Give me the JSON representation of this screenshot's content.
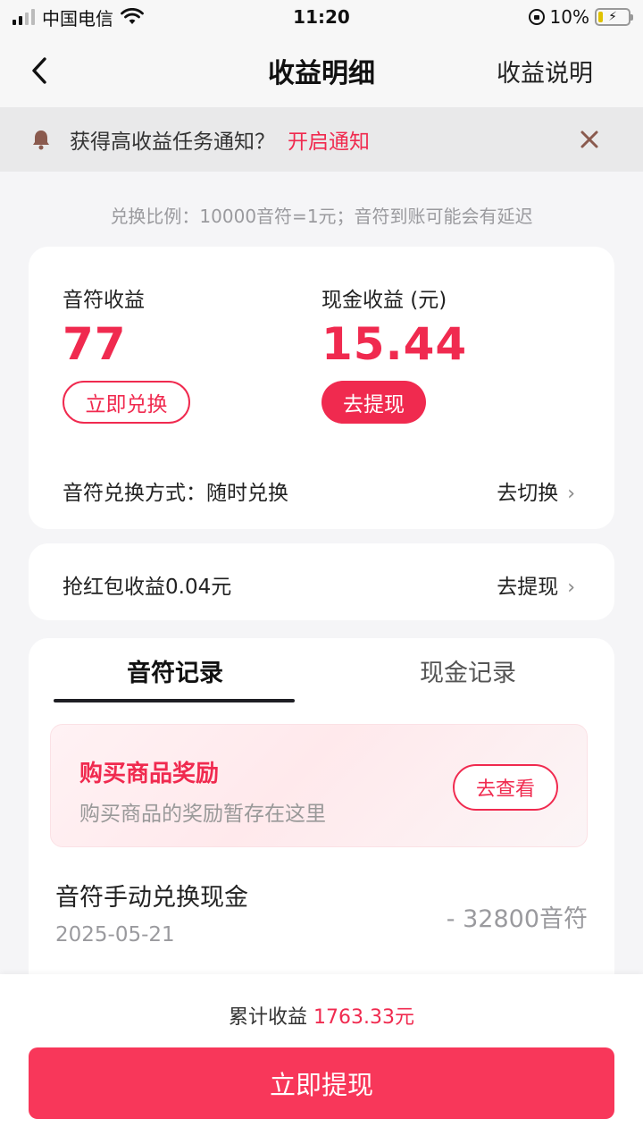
{
  "status_bar": {
    "carrier": "中国电信",
    "time": "11:20",
    "battery": "10%",
    "icons": [
      "signal-icon",
      "wifi-icon",
      "rotation-lock-icon",
      "battery-charging-icon"
    ]
  },
  "nav": {
    "title": "收益明细",
    "right_link": "收益说明",
    "back_icon": "chevron-left-icon"
  },
  "notice": {
    "text": "获得高收益任务通知？",
    "link": "开启通知",
    "icon": "bell-icon",
    "close_icon": "close-icon"
  },
  "exchange_rate": "兑换比例：10000音符=1元；音符到账可能会有延迟",
  "earnings": {
    "note_label": "音符收益",
    "note_value": "77",
    "note_button": "立即兑换",
    "cash_label": "现金收益 (元)",
    "cash_value": "15.44",
    "cash_button": "去提现",
    "mode_label": "音符兑换方式：随时兑换",
    "mode_link": "去切换"
  },
  "red_packet": {
    "label": "抢红包收益0.04元",
    "link": "去提现"
  },
  "records": {
    "tabs": [
      {
        "label": "音符记录",
        "active": true
      },
      {
        "label": "现金记录",
        "active": false
      }
    ],
    "promo": {
      "title": "购买商品奖励",
      "subtitle": "购买商品的奖励暂存在这里",
      "button": "去查看"
    },
    "items": [
      {
        "title": "音符手动兑换现金",
        "date": "2025-05-21",
        "amount": "- 32800音符"
      }
    ]
  },
  "footer": {
    "total_label": "累计收益",
    "total_value": "1763.33元",
    "withdraw_button": "立即提现"
  },
  "colors": {
    "accent": "#f02a4f",
    "button": "#f8375a",
    "background": "#f5f5f7"
  }
}
